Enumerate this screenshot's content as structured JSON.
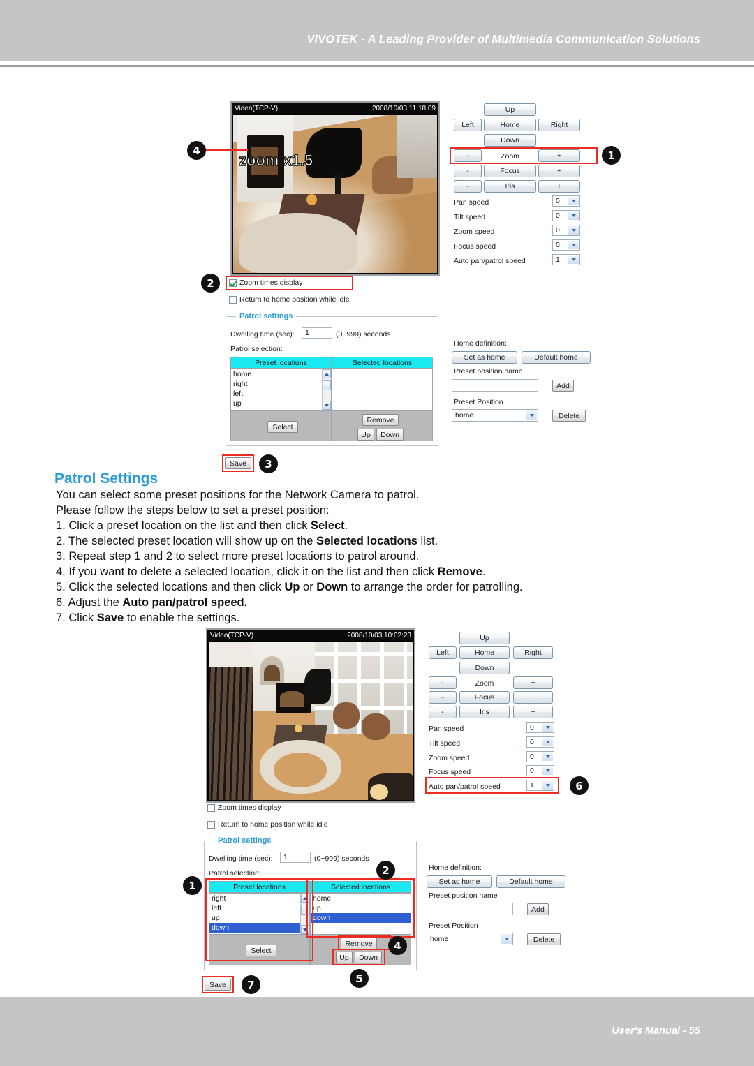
{
  "header": {
    "brand": "VIVOTEK - A Leading Provider of Multimedia Communication Solutions"
  },
  "footer": {
    "folio": "User's Manual - 55"
  },
  "section": {
    "heading": "Patrol Settings",
    "intro_1": "You can select some preset positions for the Network Camera to patrol.",
    "intro_2": "Please follow the steps below to set a preset position:",
    "steps": [
      {
        "num": "1. ",
        "a": "Click a preset location on the list and then click ",
        "b": "Select",
        "c": "."
      },
      {
        "num": "2. ",
        "a": "The selected preset location will show up on the ",
        "b": "Selected locations",
        "c": " list."
      },
      {
        "num": "3. ",
        "a": "Repeat step 1 and 2 to select more preset locations to patrol around.",
        "b": "",
        "c": ""
      },
      {
        "num": "4. ",
        "a": "If you want to delete a selected location, click it on the list and then click ",
        "b": "Remove",
        "c": "."
      },
      {
        "num": "5. ",
        "a": "Click the selected locations and then click ",
        "b": "Up",
        "c": " or ",
        "d": "Down",
        "e": " to arrange the order for patrolling."
      },
      {
        "num": "6. ",
        "a": "Adjust the ",
        "b": "Auto pan/patrol speed.",
        "c": ""
      },
      {
        "num": "7. ",
        "a": "Click ",
        "b": "Save",
        "c": " to enable the settings."
      }
    ]
  },
  "top_figure": {
    "video": {
      "title": "Video(TCP-V)",
      "timestamp": "2008/10/03 11:18:09",
      "overlay": "zoom x1.5"
    },
    "ptz": {
      "up": "Up",
      "left": "Left",
      "home": "Home",
      "right": "Right",
      "down": "Down",
      "minus": "-",
      "plus": "+",
      "zoom": "Zoom",
      "focus": "Focus",
      "iris": "Iris"
    },
    "speeds": [
      {
        "label": "Pan speed",
        "value": "0"
      },
      {
        "label": "Tilt speed",
        "value": "0"
      },
      {
        "label": "Zoom speed",
        "value": "0"
      },
      {
        "label": "Focus speed",
        "value": "0"
      },
      {
        "label": "Auto pan/patrol speed",
        "value": "1"
      }
    ],
    "checks": [
      {
        "label": "Zoom times display",
        "checked": true
      },
      {
        "label": "Return to home position while idle",
        "checked": false
      }
    ],
    "patrol": {
      "title": "Patrol settings",
      "dwell_label": "Dwelling time (sec):",
      "dwell_value": "1",
      "dwell_hint": "(0~999) seconds",
      "selection_label": "Patrol selection:",
      "col_preset": "Preset locations",
      "col_selected": "Selected locations",
      "preset_items": [
        "home",
        "right",
        "left",
        "up"
      ],
      "selected_items": [],
      "select_btn": "Select",
      "remove_btn": "Remove",
      "up_btn": "Up",
      "down_btn": "Down"
    },
    "home_def": {
      "title": "Home definition:",
      "set_as_home": "Set as home",
      "default_home": "Default home",
      "preset_name_label": "Preset position name",
      "preset_name_value": "",
      "add_btn": "Add",
      "preset_position_label": "Preset Position",
      "preset_position_value": "home",
      "delete_btn": "Delete"
    },
    "save_btn": "Save",
    "callouts": [
      "1",
      "2",
      "3",
      "4"
    ]
  },
  "bottom_figure": {
    "video": {
      "title": "Video(TCP-V)",
      "timestamp": "2008/10/03 10:02:23"
    },
    "ptz": {
      "up": "Up",
      "left": "Left",
      "home": "Home",
      "right": "Right",
      "down": "Down",
      "minus": "-",
      "plus": "+",
      "zoom": "Zoom",
      "focus": "Focus",
      "iris": "Iris"
    },
    "speeds": [
      {
        "label": "Pan speed",
        "value": "0"
      },
      {
        "label": "Tilt speed",
        "value": "0"
      },
      {
        "label": "Zoom speed",
        "value": "0"
      },
      {
        "label": "Focus speed",
        "value": "0"
      },
      {
        "label": "Auto pan/patrol speed",
        "value": "1"
      }
    ],
    "checks": [
      {
        "label": "Zoom times display",
        "checked": false
      },
      {
        "label": "Return to home position while idle",
        "checked": false
      }
    ],
    "patrol": {
      "title": "Patrol settings",
      "dwell_label": "Dwelling time (sec):",
      "dwell_value": "1",
      "dwell_hint": "(0~999) seconds",
      "selection_label": "Patrol selection:",
      "col_preset": "Preset locations",
      "col_selected": "Selected locations",
      "preset_items": [
        "right",
        "left",
        "up",
        "down"
      ],
      "preset_selected_index": 3,
      "selected_items": [
        "home",
        "up",
        "down"
      ],
      "selected_selected_index": 2,
      "select_btn": "Select",
      "remove_btn": "Remove",
      "up_btn": "Up",
      "down_btn": "Down"
    },
    "home_def": {
      "title": "Home definition:",
      "set_as_home": "Set as home",
      "default_home": "Default home",
      "preset_name_label": "Preset position name",
      "preset_name_value": "",
      "add_btn": "Add",
      "preset_position_label": "Preset Position",
      "preset_position_value": "home",
      "delete_btn": "Delete"
    },
    "save_btn": "Save",
    "callouts": [
      "1",
      "2",
      "4",
      "5",
      "6",
      "7"
    ]
  },
  "colors": {
    "band": "#c3c6c5",
    "accent_blue": "#2e9bd6",
    "highlight_red": "#ee2b21",
    "list_header": "#1ae9f2",
    "list_selected": "#2f5fd0"
  }
}
